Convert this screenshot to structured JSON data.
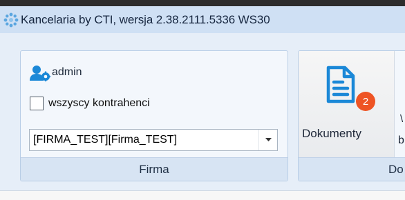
{
  "window": {
    "title": "Kancelaria by CTI, wersja  2.38.2111.5336 WS30"
  },
  "ribbon": {
    "firma_group": {
      "user_name": "admin",
      "all_contractors_checkbox": {
        "label": "wszyscy kontrahenci",
        "checked": false
      },
      "company_select": {
        "value": "[FIRMA_TEST][Firma_TEST]"
      },
      "footer_label": "Firma"
    },
    "dokumenty_group": {
      "button_label": "Dokumenty",
      "badge_count": "2",
      "partial_label_top": "\\",
      "partial_label_bottom": "b",
      "footer_label": "Do"
    }
  },
  "colors": {
    "accent_blue": "#1b88d7",
    "badge_orange": "#ee5424",
    "titlebar": "#cfe0f4"
  }
}
